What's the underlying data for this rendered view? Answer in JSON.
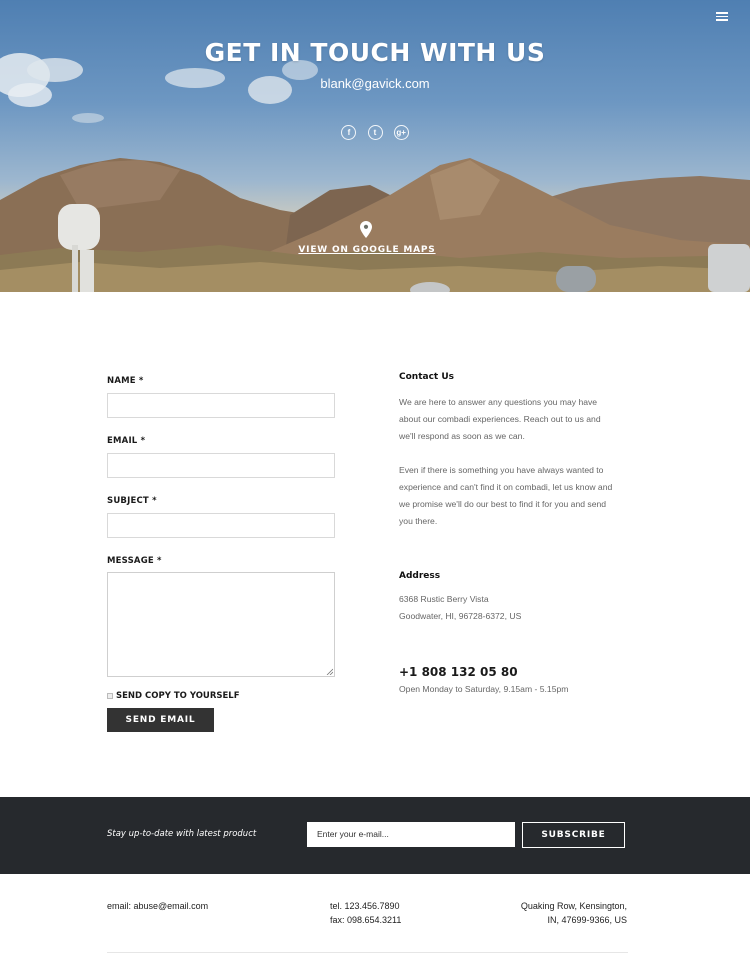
{
  "hero": {
    "title": "GET IN TOUCH WITH US",
    "email": "blank@gavick.com",
    "social": [
      {
        "icon": "facebook-icon",
        "glyph": "f"
      },
      {
        "icon": "twitter-icon",
        "glyph": "t"
      },
      {
        "icon": "google-plus-icon",
        "glyph": "g+"
      }
    ],
    "maps_link": "VIEW ON GOOGLE MAPS"
  },
  "form": {
    "name_label": "NAME *",
    "email_label": "EMAIL *",
    "subject_label": "SUBJECT *",
    "message_label": "MESSAGE *",
    "name_value": "",
    "email_value": "",
    "subject_value": "",
    "message_value": "",
    "copy_label": "SEND COPY TO YOURSELF",
    "copy_checked": false,
    "send_label": "SEND EMAIL"
  },
  "contact": {
    "heading": "Contact Us",
    "paragraph1_lines": [
      "We are here to answer any questions you may have",
      "about our combadi experiences. Reach out to us and",
      "we'll respond as soon as we can."
    ],
    "paragraph2_lines": [
      "Even if there is something you have always wanted to",
      "experience and can't find it on combadi, let us know and",
      "we promise we'll do our best to find it for you and send",
      "you there."
    ],
    "address_heading": "Address",
    "address_line1": "6368 Rustic Berry Vista",
    "address_line2": "Goodwater, HI, 96728-6372, US",
    "phone": "+1 808 132 05 80",
    "hours": "Open Monday to Saturday, 9.15am - 5.15pm"
  },
  "newsletter": {
    "tagline": "Stay up-to-date with latest product",
    "input_placeholder": "Enter your e-mail...",
    "subscribe_label": "SUBSCRIBE"
  },
  "footer": {
    "email": "email: abuse@email.com",
    "tel": "tel. 123.456.7890",
    "fax": "fax: 098.654.3211",
    "address_line1": "Quaking Row, Kensington,",
    "address_line2": "IN, 47699-9366, US"
  },
  "colors": {
    "dark_button": "#333333",
    "newsletter_bg": "#26292d",
    "sky": "#5e8bbd"
  }
}
